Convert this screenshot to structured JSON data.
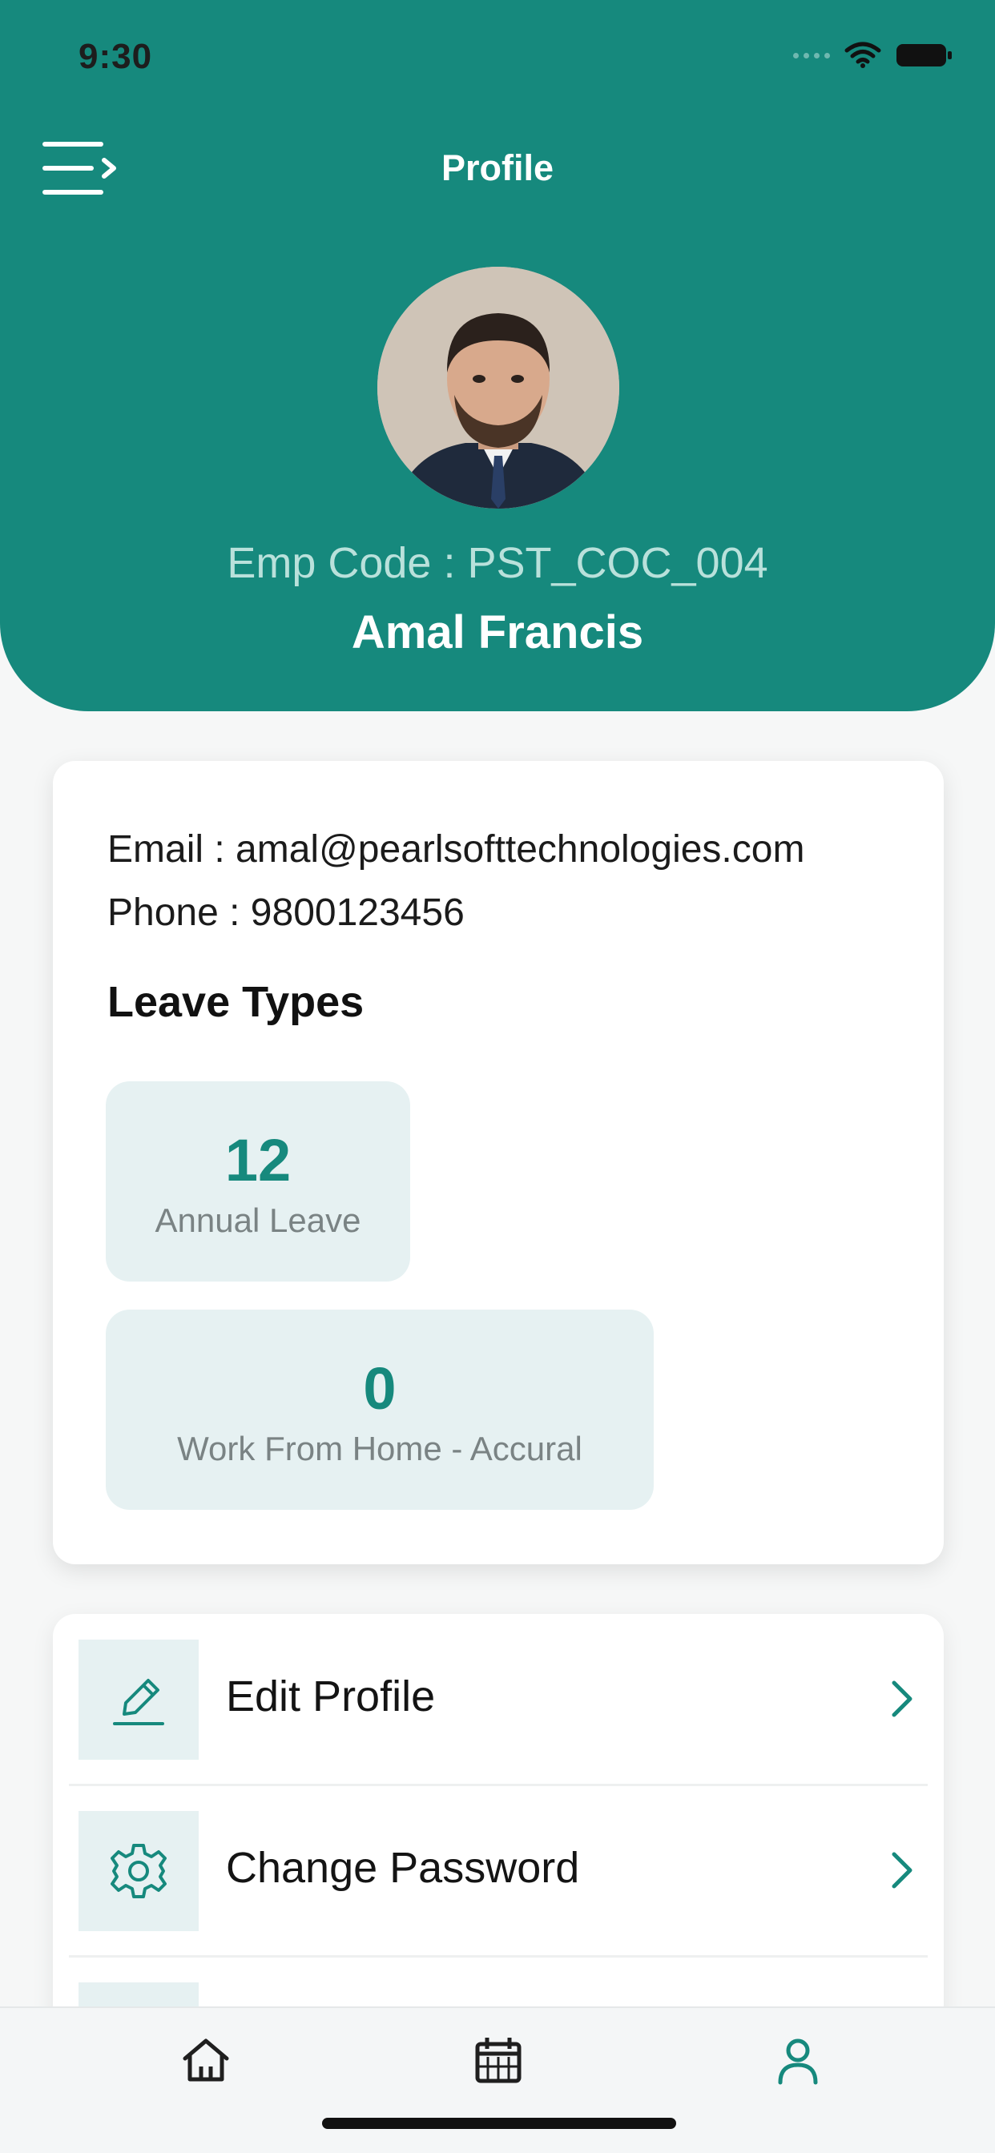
{
  "status_bar": {
    "time": "9:30"
  },
  "header": {
    "title": "Profile",
    "emp_code": "Emp Code : PST_COC_004",
    "name": "Amal Francis",
    "accent_color": "#16897d"
  },
  "profile_info": {
    "email": "Email : amal@pearlsofttechnologies.com",
    "phone": "Phone : 9800123456"
  },
  "leave_types": {
    "title": "Leave Types",
    "items": [
      {
        "value": "12",
        "label": "Annual Leave"
      },
      {
        "value": "0",
        "label": "Work From Home -  Accural"
      }
    ]
  },
  "menu": {
    "items": [
      {
        "label": "Edit Profile",
        "icon": "pencil-icon"
      },
      {
        "label": "Change Password",
        "icon": "gear-icon"
      },
      {
        "label": "",
        "icon": ""
      }
    ]
  },
  "tabbar": {
    "items": [
      {
        "icon": "home-icon",
        "active": false
      },
      {
        "icon": "calendar-icon",
        "active": false
      },
      {
        "icon": "profile-icon",
        "active": true
      }
    ]
  }
}
